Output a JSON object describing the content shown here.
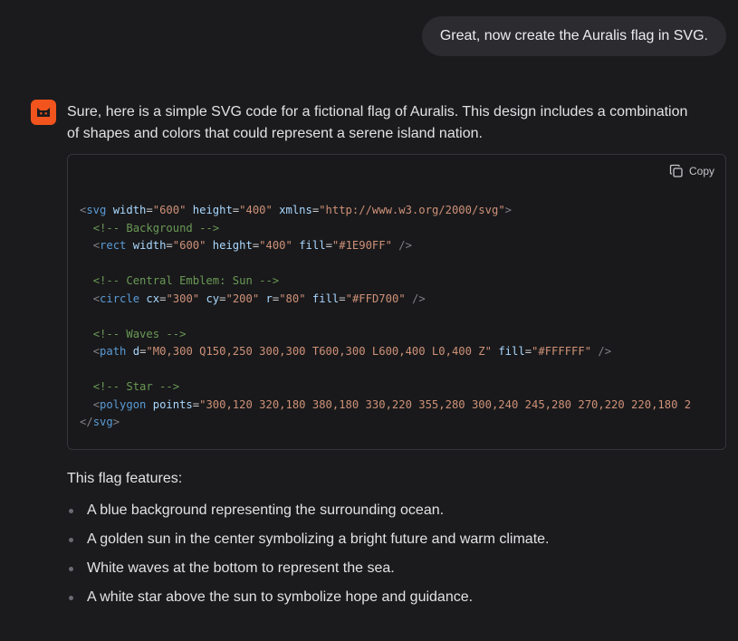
{
  "user_message": "Great, now create the Auralis flag in SVG.",
  "assistant": {
    "avatar_icon": "cat-face-icon",
    "intro": "Sure, here is a simple SVG code for a fictional flag of Auralis. This design includes a combination of shapes and colors that could represent a serene island nation.",
    "code_block": {
      "copy_label": "Copy",
      "lines": [
        "<svg width=\"600\" height=\"400\" xmlns=\"http://www.w3.org/2000/svg\">",
        "  <!-- Background -->",
        "  <rect width=\"600\" height=\"400\" fill=\"#1E90FF\" />",
        "",
        "  <!-- Central Emblem: Sun -->",
        "  <circle cx=\"300\" cy=\"200\" r=\"80\" fill=\"#FFD700\" />",
        "",
        "  <!-- Waves -->",
        "  <path d=\"M0,300 Q150,250 300,300 T600,300 L600,400 L0,400 Z\" fill=\"#FFFFFF\" />",
        "",
        "  <!-- Star -->",
        "  <polygon points=\"300,120 320,180 380,180 330,220 355,280 300,240 245,280 270,220 220,180 2",
        "</svg>"
      ]
    },
    "features_heading": "This flag features:",
    "features": [
      "A blue background representing the surrounding ocean.",
      "A golden sun in the center symbolizing a bright future and warm climate.",
      "White waves at the bottom to represent the sea.",
      "A white star above the sun to symbolize hope and guidance."
    ]
  },
  "colors": {
    "background": "#1b1b1e",
    "avatar": "#f1541c",
    "user_bubble": "#2c2c30"
  }
}
